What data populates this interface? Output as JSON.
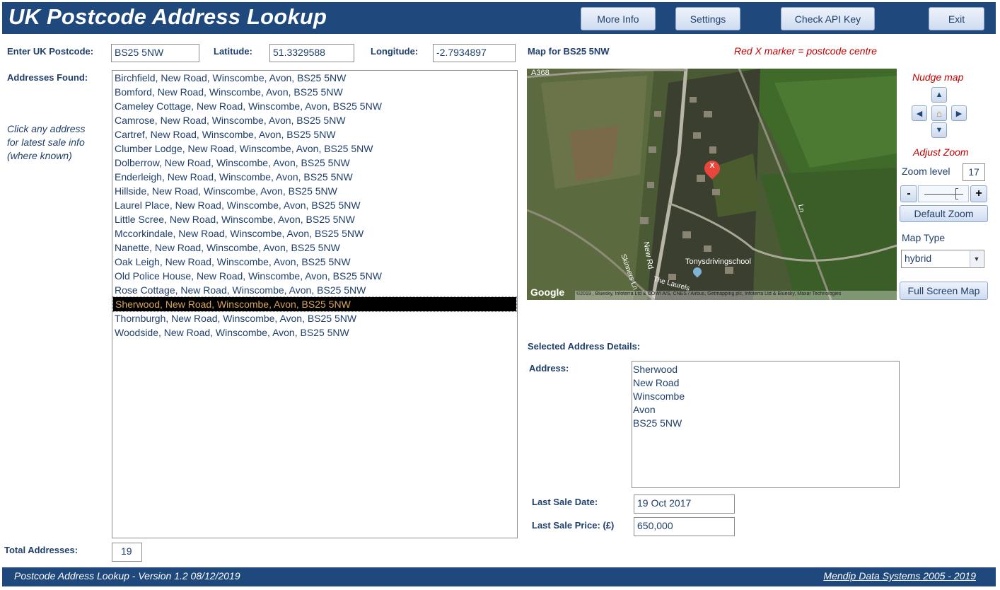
{
  "header": {
    "title": "UK Postcode Address Lookup",
    "buttons": {
      "more_info": "More Info",
      "settings": "Settings",
      "check_api": "Check API Key",
      "exit": "Exit"
    }
  },
  "search": {
    "postcode_label": "Enter UK Postcode:",
    "postcode_value": "BS25 5NW",
    "latitude_label": "Latitude:",
    "latitude_value": "51.3329588",
    "longitude_label": "Longitude:",
    "longitude_value": "-2.7934897"
  },
  "addresses": {
    "label": "Addresses Found:",
    "hint": [
      "Click any address",
      "for latest sale info",
      "(where known)"
    ],
    "items": [
      "Birchfield, New Road, Winscombe, Avon, BS25 5NW",
      "Bomford, New Road, Winscombe, Avon, BS25 5NW",
      "Cameley Cottage, New Road, Winscombe, Avon, BS25 5NW",
      "Camrose, New Road, Winscombe, Avon, BS25 5NW",
      "Cartref, New Road, Winscombe, Avon, BS25 5NW",
      "Clumber Lodge, New Road, Winscombe, Avon, BS25 5NW",
      "Dolberrow, New Road, Winscombe, Avon, BS25 5NW",
      "Enderleigh, New Road, Winscombe, Avon, BS25 5NW",
      "Hillside, New Road, Winscombe, Avon, BS25 5NW",
      "Laurel Place, New Road, Winscombe, Avon, BS25 5NW",
      "Little Scree, New Road, Winscombe, Avon, BS25 5NW",
      "Mccorkindale, New Road, Winscombe, Avon, BS25 5NW",
      "Nanette, New Road, Winscombe, Avon, BS25 5NW",
      "Oak Leigh, New Road, Winscombe, Avon, BS25 5NW",
      "Old Police House, New Road, Winscombe, Avon, BS25 5NW",
      "Rose Cottage, New Road, Winscombe, Avon, BS25 5NW",
      "Sherwood, New Road, Winscombe, Avon, BS25 5NW",
      "Thornburgh, New Road, Winscombe, Avon, BS25 5NW",
      "Woodside, New Road, Winscombe, Avon, BS25 5NW"
    ],
    "selected_index": 16,
    "total_label": "Total Addresses:",
    "total_value": "19"
  },
  "map": {
    "title": "Map for BS25 5NW",
    "marker_note": "Red X marker =  postcode centre",
    "marker_label": "X",
    "road_a368": "A368",
    "road_new_rd": "New Rd",
    "road_skinners": "Skinners Ln",
    "road_laurels": "The Laurels",
    "road_ln": "Ln",
    "poi": "Tonysdrivingschool",
    "google": "Google",
    "attribution": "©2019 , Bluesky, Infoterra Ltd & COWI A/S, CNES / Airbus, Getmapping plc, Infoterra Ltd & Bluesky, Maxar Technologies"
  },
  "controls": {
    "nudge_label": "Nudge map",
    "adjust_zoom_label": "Adjust Zoom",
    "zoom_level_label": "Zoom level",
    "zoom_level_value": "17",
    "zoom_minus": "-",
    "zoom_plus": "+",
    "default_zoom": "Default Zoom",
    "map_type_label": "Map Type",
    "map_type_value": "hybrid",
    "full_screen": "Full Screen Map"
  },
  "details": {
    "heading": "Selected Address Details:",
    "address_label": "Address:",
    "address_lines": [
      "Sherwood",
      "New Road",
      "Winscombe",
      "Avon",
      "BS25 5NW"
    ],
    "sale_date_label": "Last Sale Date:",
    "sale_date_value": "19 Oct 2017",
    "sale_price_label": "Last Sale Price:  (£)",
    "sale_price_value": "650,000"
  },
  "footer": {
    "left": "Postcode Address Lookup - Version 1.2  08/12/2019",
    "right": "Mendip Data Systems 2005 - 2019"
  },
  "colors": {
    "title_bar": "#1f497d",
    "selected_bg": "#000000",
    "selected_text": "#d9a55a",
    "note_red": "#c00000"
  }
}
